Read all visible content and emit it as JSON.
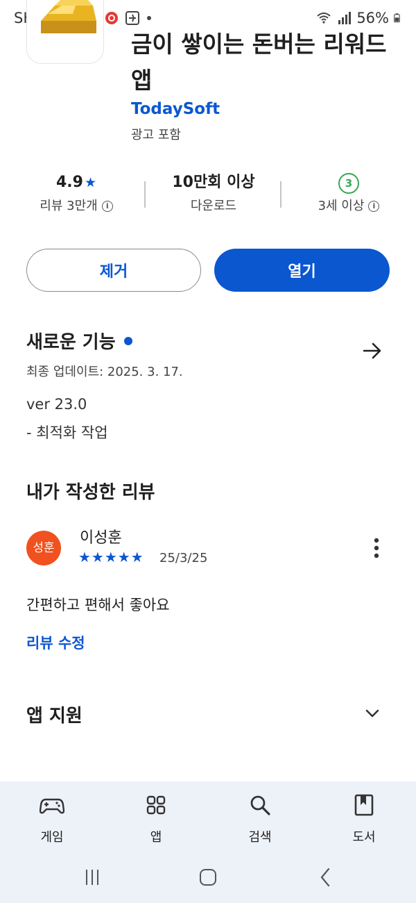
{
  "status_bar": {
    "carrier_time": "SKT 7:16",
    "battery": "56%",
    "icons": [
      "pen-icon",
      "record-icon",
      "airplane-icon",
      "wifi-icon",
      "signal-icon",
      "battery-icon"
    ]
  },
  "app": {
    "title": "금이 쌓이는 돈버는 리워드 앱",
    "developer": "TodaySoft",
    "contains_ads": "광고 포함"
  },
  "stats": {
    "rating": "4.9",
    "rating_star": "★",
    "reviews": "리뷰 3만개",
    "downloads": "10만회 이상",
    "downloads_label": "다운로드",
    "age_badge": "3",
    "age_label": "3세 이상"
  },
  "buttons": {
    "remove": "제거",
    "open": "열기"
  },
  "whats_new": {
    "title": "새로운 기능",
    "updated": "최종 업데이트: 2025. 3. 17.",
    "version": "ver 23.0",
    "note": "- 최적화 작업"
  },
  "my_review": {
    "title": "내가 작성한 리뷰",
    "avatar_text": "성훈",
    "name": "이성훈",
    "stars": "★★★★★",
    "rating": 5,
    "date": "25/3/25",
    "text": "간편하고 편해서 좋아요",
    "edit": "리뷰 수정"
  },
  "app_support": {
    "title": "앱 지원"
  },
  "bottom_nav": {
    "items": [
      {
        "label": "게임",
        "icon": "gamepad-icon"
      },
      {
        "label": "앱",
        "icon": "apps-grid-icon"
      },
      {
        "label": "검색",
        "icon": "search-icon"
      },
      {
        "label": "도서",
        "icon": "book-icon"
      }
    ]
  },
  "colors": {
    "accent": "#0b57d0",
    "avatar": "#f0511e",
    "age_badge": "#34a853",
    "nav_bg": "#edf1f8"
  }
}
